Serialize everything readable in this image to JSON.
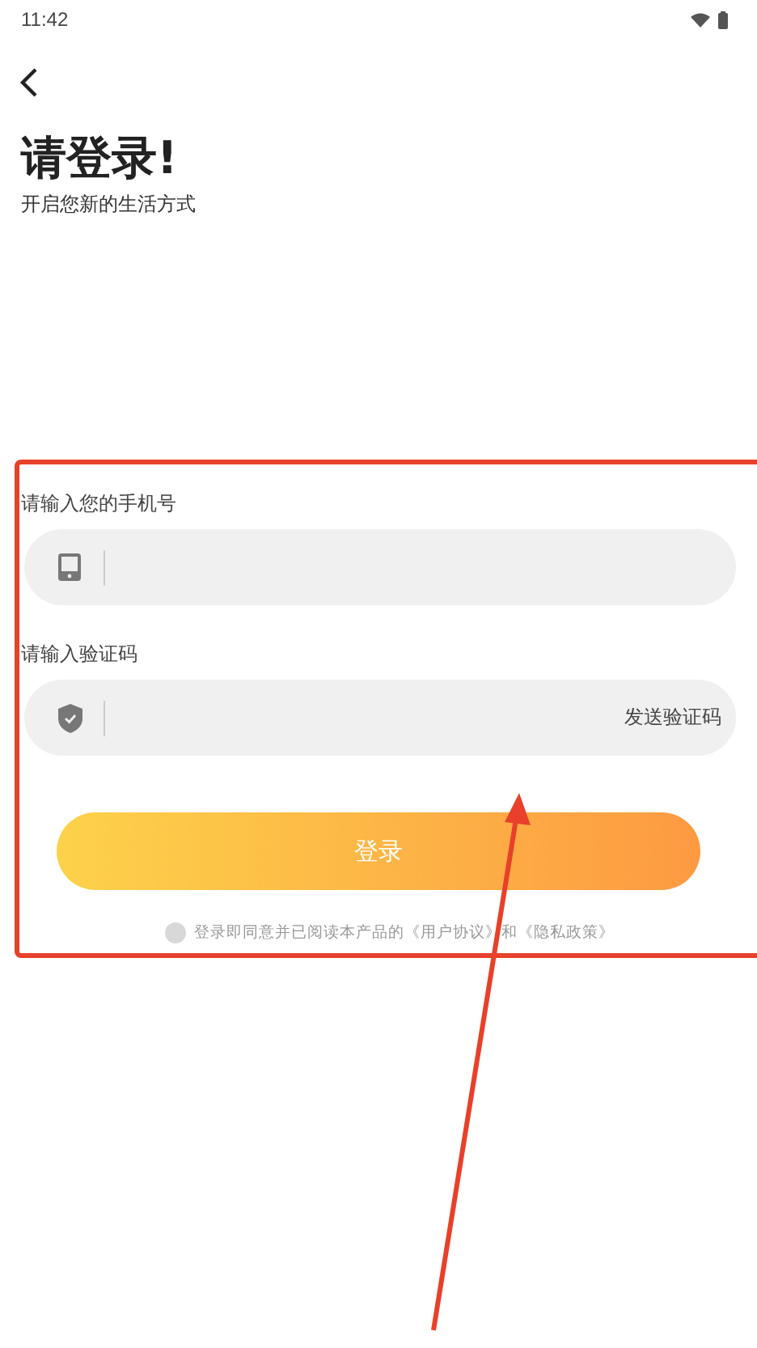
{
  "status_bar": {
    "time": "11:42"
  },
  "header": {
    "title": "请登录!",
    "subtitle": "开启您新的生活方式"
  },
  "fields": [
    {
      "kind": "phone",
      "label": "请输入您的手机号"
    },
    {
      "kind": "code",
      "label": "请输入验证码",
      "action": "发送验证码"
    }
  ],
  "login_button": "登录",
  "agreement": {
    "checked": false,
    "text": "登录即同意并已阅读本产品的《用户协议》和《隐私政策》"
  }
}
